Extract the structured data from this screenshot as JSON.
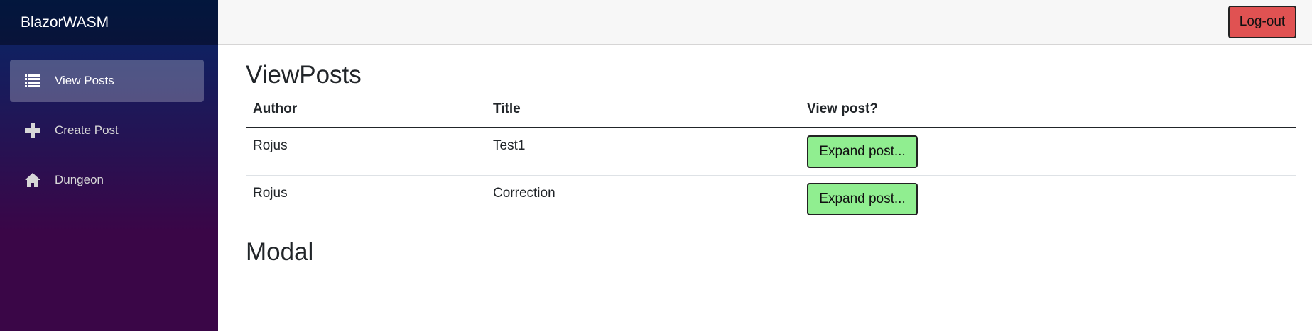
{
  "sidebar": {
    "brand": "BlazorWASM",
    "items": [
      {
        "label": "View Posts",
        "icon": "list-icon",
        "active": true
      },
      {
        "label": "Create Post",
        "icon": "plus-icon",
        "active": false
      },
      {
        "label": "Dungeon",
        "icon": "home-icon",
        "active": false
      }
    ]
  },
  "topbar": {
    "logout_label": "Log-out"
  },
  "main": {
    "title": "ViewPosts",
    "table": {
      "headers": [
        "Author",
        "Title",
        "View post?"
      ],
      "rows": [
        {
          "author": "Rojus",
          "title": "Test1",
          "action": "Expand post..."
        },
        {
          "author": "Rojus",
          "title": "Correction",
          "action": "Expand post..."
        }
      ]
    },
    "modal_heading": "Modal"
  },
  "colors": {
    "sidebar_top": "#052767",
    "sidebar_bottom": "#3a0647",
    "logout_bg": "#e05252",
    "expand_bg": "#90ee90"
  }
}
